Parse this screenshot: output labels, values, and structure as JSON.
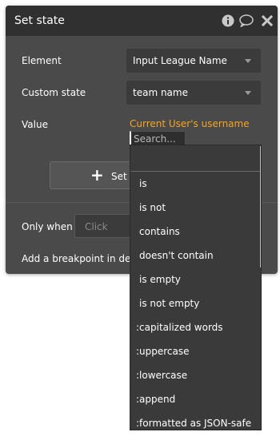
{
  "panel": {
    "title": "Set state",
    "info_icon": "info-icon",
    "comment_icon": "comment-icon",
    "close_icon": "close-icon"
  },
  "form": {
    "element_label": "Element",
    "element_value": "Input League Name",
    "custom_state_label": "Custom state",
    "custom_state_value": "team name",
    "value_label": "Value",
    "value_expression": "Current User's username",
    "search_placeholder": "Search...",
    "set_button_label": "Set",
    "only_when_label": "Only when",
    "only_when_placeholder": "Click",
    "breakpoint_label": "Add a breakpoint in deb"
  },
  "dropdown": {
    "items": [
      "is",
      "is not",
      "contains",
      "doesn't contain",
      "is empty",
      "is not empty",
      ":capitalized words",
      ":uppercase",
      ":lowercase",
      ":append",
      ":formatted as JSON-safe"
    ]
  },
  "colors": {
    "panel_bg": "#4a4a4a",
    "title_bg": "#303030",
    "expression_color": "#f5a623",
    "dropdown_bg": "#3a3a3a"
  }
}
